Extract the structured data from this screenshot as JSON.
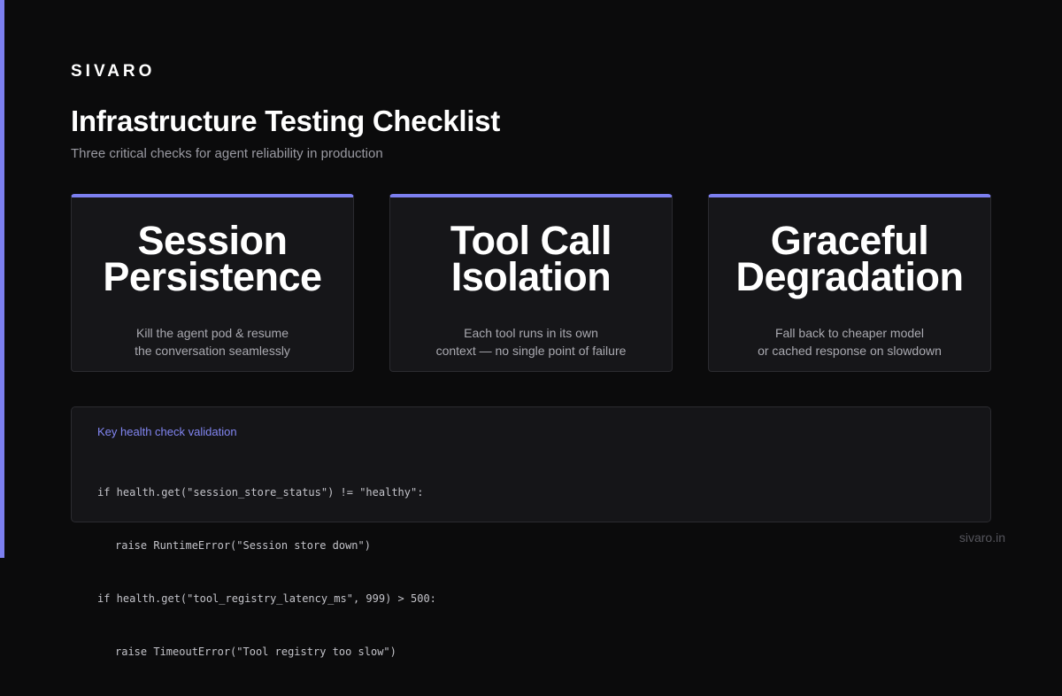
{
  "brand": "SIVARO",
  "header": {
    "title": "Infrastructure Testing Checklist",
    "subtitle": "Three critical checks for agent reliability in production"
  },
  "cards": [
    {
      "title_lines": [
        "Session",
        "Persistence"
      ],
      "desc_lines": [
        "Kill the agent pod & resume",
        "the conversation seamlessly"
      ]
    },
    {
      "title_lines": [
        "Tool Call",
        "Isolation"
      ],
      "desc_lines": [
        "Each tool runs in its own",
        "context — no single point of failure"
      ]
    },
    {
      "title_lines": [
        "Graceful",
        "Degradation"
      ],
      "desc_lines": [
        "Fall back to cheaper model",
        "or cached response on slowdown"
      ]
    }
  ],
  "code": {
    "label": "Key health check validation",
    "lines": [
      "if health.get(\"session_store_status\") != \"healthy\":",
      "raise RuntimeError(\"Session store down\")",
      "if health.get(\"tool_registry_latency_ms\", 999) > 500:",
      "raise TimeoutError(\"Tool registry too slow\")"
    ]
  },
  "footer": {
    "domain": "sivaro.in"
  },
  "colors": {
    "background": "#0b0b0c",
    "accent": "#7c7ff0",
    "card_background": "#161619",
    "muted_text": "#9a9aa2"
  }
}
